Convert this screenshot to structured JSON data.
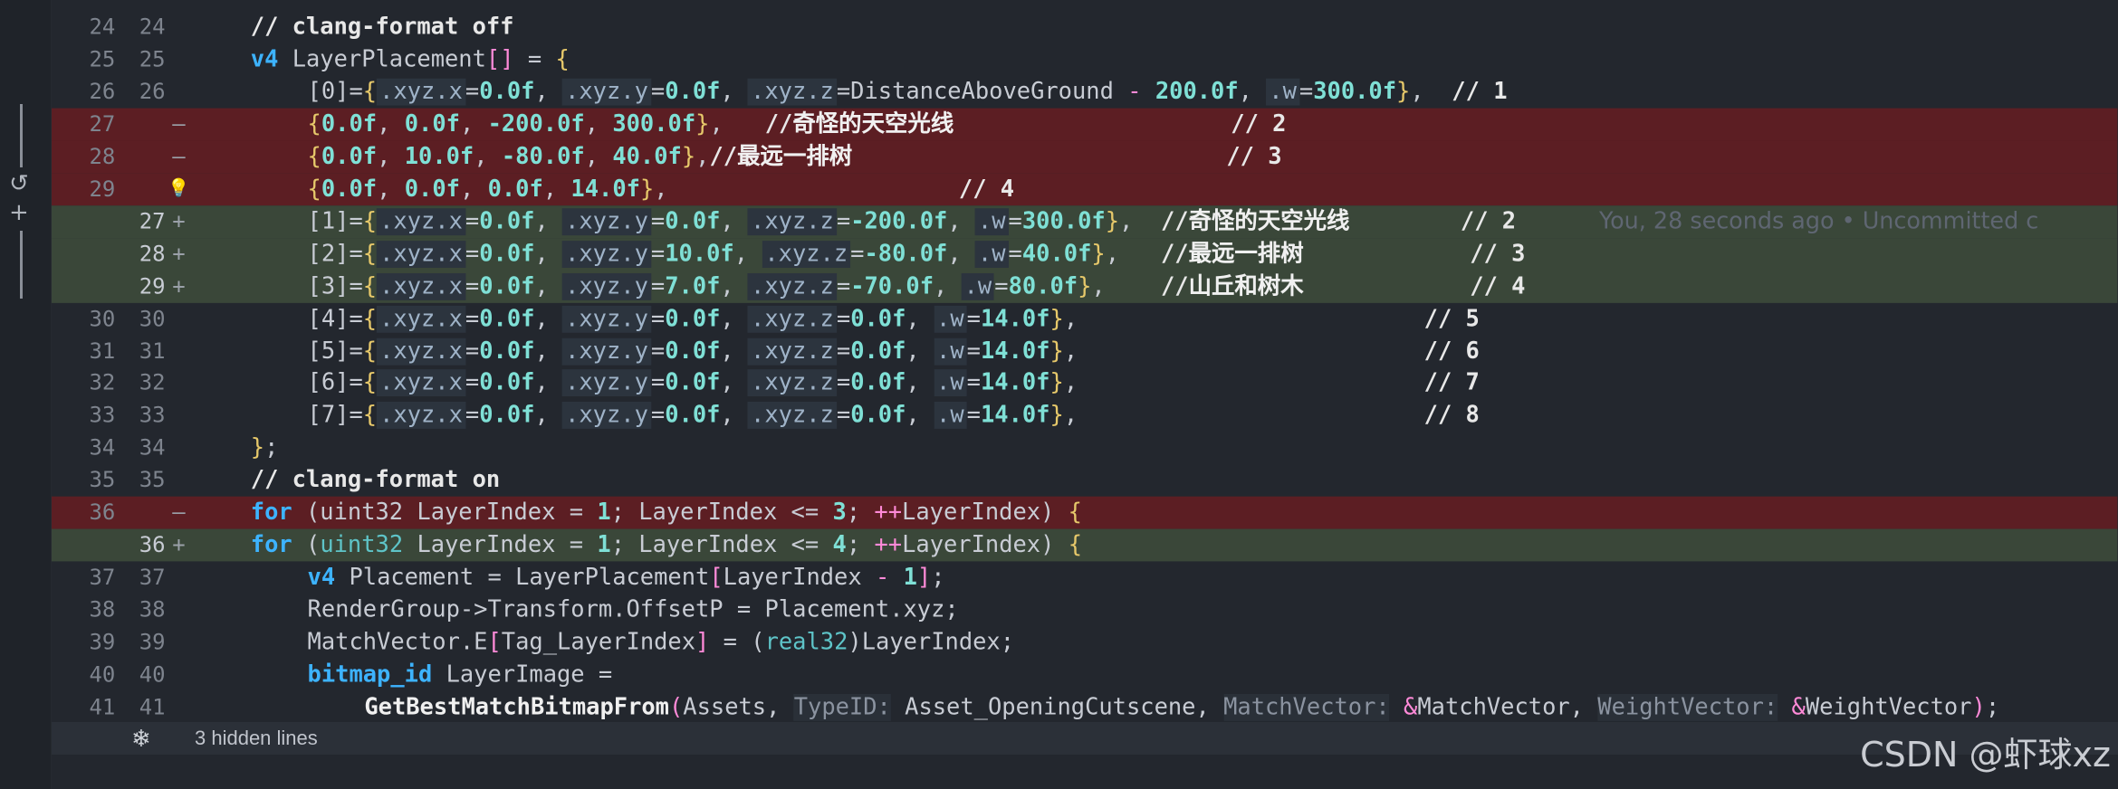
{
  "editor": {
    "rows": [
      {
        "old": "24",
        "new": "24",
        "mark": "",
        "type": "ctx",
        "indent": 1,
        "html": "<span class=\"cm\">// clang-format off</span>"
      },
      {
        "old": "25",
        "new": "25",
        "mark": "",
        "type": "ctx",
        "indent": 1,
        "html": "<span class=\"kw\">v4</span> LayerPlacement<span class=\"op\">[]</span> = <span class=\"br\">{</span>"
      },
      {
        "old": "26",
        "new": "26",
        "mark": "",
        "type": "ctx",
        "indent": 2,
        "html": "[0]=<span class=\"br\">{</span><span class=\"fld\">.xyz.x</span>=<span class=\"num\">0.0f</span>, <span class=\"fld\">.xyz.y</span>=<span class=\"num\">0.0f</span>, <span class=\"fld\">.xyz.z</span>=DistanceAboveGround <span class=\"op\">-</span> <span class=\"num\">200.0f</span>, <span class=\"fld\">.w</span>=<span class=\"num\">300.0f</span><span class=\"br\">}</span>,  <span class=\"cm\">// 1</span>"
      },
      {
        "old": "27",
        "new": "",
        "mark": "—",
        "type": "del",
        "indent": 2,
        "html": "<span class=\"br\">{</span><span class=\"num\">0.0f</span>, <span class=\"num\">0.0f</span>, <span class=\"num\">-200.0f</span>, <span class=\"num\">300.0f</span><span class=\"br\">}</span>,   <span class=\"cm\">//</span><span class=\"cjk\">奇怪的天空光线</span>                    <span class=\"cm\">// 2</span>"
      },
      {
        "old": "28",
        "new": "",
        "mark": "—",
        "type": "del",
        "indent": 2,
        "html": "<span class=\"br\">{</span><span class=\"num\">0.0f</span>, <span class=\"num\">10.0f</span>, <span class=\"num\">-80.0f</span>, <span class=\"num\">40.0f</span><span class=\"br\">}</span>,<span class=\"cm\">//</span><span class=\"cjk\">最远一排树</span>                           <span class=\"cm\">// 3</span>"
      },
      {
        "old": "29",
        "new": "",
        "mark": "bulb",
        "type": "del",
        "indent": 2,
        "html": "<span class=\"br\">{</span><span class=\"num\">0.0f</span>, <span class=\"num\">0.0f</span>, <span class=\"num\">0.0f</span>, <span class=\"num\">14.0f</span><span class=\"br\">}</span>,                     <span class=\"cm\">// 4</span>"
      },
      {
        "old": "",
        "new": "27",
        "mark": "+",
        "type": "add",
        "indent": 2,
        "html": "[1]=<span class=\"br\">{</span><span class=\"fld\">.xyz.x</span>=<span class=\"num\">0.0f</span>, <span class=\"fld\">.xyz.y</span>=<span class=\"num\">0.0f</span>, <span class=\"fld\">.xyz.z</span>=<span class=\"num\">-200.0f</span>, <span class=\"fld\">.w</span>=<span class=\"num\">300.0f</span><span class=\"br\">}</span>,  <span class=\"cm\">//</span><span class=\"cjk\">奇怪的天空光线</span>        <span class=\"cm\">// 2</span>      <span class=\"blame\">You, 28 seconds ago • Uncommitted c</span>"
      },
      {
        "old": "",
        "new": "28",
        "mark": "+",
        "type": "add",
        "indent": 2,
        "html": "[2]=<span class=\"br\">{</span><span class=\"fld\">.xyz.x</span>=<span class=\"num\">0.0f</span>, <span class=\"fld\">.xyz.y</span>=<span class=\"num\">10.0f</span>, <span class=\"fld\">.xyz.z</span>=<span class=\"num\">-80.0f</span>, <span class=\"fld\">.w</span>=<span class=\"num\">40.0f</span><span class=\"br\">}</span>,   <span class=\"cm\">//</span><span class=\"cjk\">最远一排树</span>            <span class=\"cm\">// 3</span>"
      },
      {
        "old": "",
        "new": "29",
        "mark": "+",
        "type": "add",
        "indent": 2,
        "html": "[3]=<span class=\"br\">{</span><span class=\"fld\">.xyz.x</span>=<span class=\"num\">0.0f</span>, <span class=\"fld\">.xyz.y</span>=<span class=\"num\">7.0f</span>, <span class=\"fld\">.xyz.z</span>=<span class=\"num\">-70.0f</span>, <span class=\"fld\">.w</span>=<span class=\"num\">80.0f</span><span class=\"br\">}</span>,    <span class=\"cm\">//</span><span class=\"cjk\">山丘和树木</span>            <span class=\"cm\">// 4</span>"
      },
      {
        "old": "30",
        "new": "30",
        "mark": "",
        "type": "ctx",
        "indent": 2,
        "html": "[4]=<span class=\"br\">{</span><span class=\"fld\">.xyz.x</span>=<span class=\"num\">0.0f</span>, <span class=\"fld\">.xyz.y</span>=<span class=\"num\">0.0f</span>, <span class=\"fld\">.xyz.z</span>=<span class=\"num\">0.0f</span>, <span class=\"fld\">.w</span>=<span class=\"num\">14.0f</span><span class=\"br\">}</span>,                         <span class=\"cm\">// 5</span>"
      },
      {
        "old": "31",
        "new": "31",
        "mark": "",
        "type": "ctx",
        "indent": 2,
        "html": "[5]=<span class=\"br\">{</span><span class=\"fld\">.xyz.x</span>=<span class=\"num\">0.0f</span>, <span class=\"fld\">.xyz.y</span>=<span class=\"num\">0.0f</span>, <span class=\"fld\">.xyz.z</span>=<span class=\"num\">0.0f</span>, <span class=\"fld\">.w</span>=<span class=\"num\">14.0f</span><span class=\"br\">}</span>,                         <span class=\"cm\">// 6</span>"
      },
      {
        "old": "32",
        "new": "32",
        "mark": "",
        "type": "ctx",
        "indent": 2,
        "html": "[6]=<span class=\"br\">{</span><span class=\"fld\">.xyz.x</span>=<span class=\"num\">0.0f</span>, <span class=\"fld\">.xyz.y</span>=<span class=\"num\">0.0f</span>, <span class=\"fld\">.xyz.z</span>=<span class=\"num\">0.0f</span>, <span class=\"fld\">.w</span>=<span class=\"num\">14.0f</span><span class=\"br\">}</span>,                         <span class=\"cm\">// 7</span>"
      },
      {
        "old": "33",
        "new": "33",
        "mark": "",
        "type": "ctx",
        "indent": 2,
        "html": "[7]=<span class=\"br\">{</span><span class=\"fld\">.xyz.x</span>=<span class=\"num\">0.0f</span>, <span class=\"fld\">.xyz.y</span>=<span class=\"num\">0.0f</span>, <span class=\"fld\">.xyz.z</span>=<span class=\"num\">0.0f</span>, <span class=\"fld\">.w</span>=<span class=\"num\">14.0f</span><span class=\"br\">}</span>,                         <span class=\"cm\">// 8</span>"
      },
      {
        "old": "34",
        "new": "34",
        "mark": "",
        "type": "ctx",
        "indent": 1,
        "html": "<span class=\"br\">}</span>;"
      },
      {
        "old": "35",
        "new": "35",
        "mark": "",
        "type": "ctx",
        "indent": 1,
        "html": "<span class=\"cm\">// clang-format on</span>"
      },
      {
        "old": "36",
        "new": "",
        "mark": "—",
        "type": "del",
        "indent": 1,
        "html": "<span class=\"kw\">for</span> (uint32 LayerIndex = <span class=\"num\">1</span>; LayerIndex &lt;= <span class=\"num\">3</span>; <span class=\"op\">++</span>LayerIndex) <span class=\"br\">{</span>"
      },
      {
        "old": "",
        "new": "36",
        "mark": "+",
        "type": "add",
        "indent": 1,
        "html": "<span class=\"kw\">for</span> (<span class=\"ty\">uint32</span> LayerIndex = <span class=\"num\">1</span>; LayerIndex &lt;= <span class=\"num\">4</span>; <span class=\"op\">++</span>LayerIndex) <span class=\"br\">{</span>"
      },
      {
        "old": "37",
        "new": "37",
        "mark": "",
        "type": "ctx",
        "indent": 2,
        "html": "<span class=\"kw\">v4</span> Placement = LayerPlacement<span class=\"op\">[</span>LayerIndex <span class=\"op\">-</span> <span class=\"num\">1</span><span class=\"op\">]</span>;"
      },
      {
        "old": "38",
        "new": "38",
        "mark": "",
        "type": "ctx",
        "indent": 2,
        "html": "RenderGroup-&gt;Transform.OffsetP = Placement.xyz;"
      },
      {
        "old": "39",
        "new": "39",
        "mark": "",
        "type": "ctx",
        "indent": 2,
        "html": "MatchVector.E<span class=\"op\">[</span>Tag_LayerIndex<span class=\"op\">]</span> = (<span class=\"ty\">real32</span>)LayerIndex;"
      },
      {
        "old": "40",
        "new": "40",
        "mark": "",
        "type": "ctx",
        "indent": 2,
        "html": "<span class=\"kw\">bitmap_id</span> LayerImage ="
      },
      {
        "old": "41",
        "new": "41",
        "mark": "",
        "type": "ctx",
        "indent": 3,
        "html": "<span class=\"fn\">GetBestMatchBitmapFrom</span><span class=\"op\">(</span>Assets, <span class=\"hint\">TypeID:</span> Asset_OpeningCutscene, <span class=\"hint\">MatchVector:</span> <span class=\"op\">&amp;</span>MatchVector, <span class=\"hint\">WeightVector:</span> <span class=\"op\">&amp;</span>WeightVector<span class=\"op\">)</span>;"
      }
    ]
  },
  "hidden_lines": {
    "label": "3 hidden lines",
    "icon": "snowflake-icon"
  },
  "watermark": "CSDN @虾球xz",
  "activity": {
    "icons": [
      "undo-icon",
      "plus-icon"
    ]
  }
}
